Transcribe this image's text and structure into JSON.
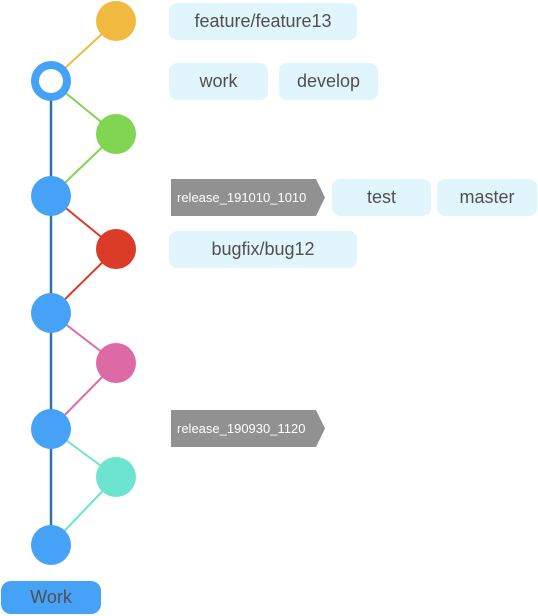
{
  "colors": {
    "main_line": "#2f72b4",
    "main_node": "#45a2f7",
    "branches": [
      "#f0ba40",
      "#80d552",
      "#da3c28",
      "#dd6aa5",
      "#6ce4d0"
    ],
    "tag_bg": "#e1f5fd",
    "release_bg": "#919191"
  },
  "labels": {
    "feature": "feature/feature13",
    "work": "work",
    "develop": "develop",
    "release1": "release_191010_1010",
    "test": "test",
    "master": "master",
    "bugfix": "bugfix/bug12",
    "release2": "release_190930_1120"
  },
  "button": {
    "label": "Work"
  }
}
